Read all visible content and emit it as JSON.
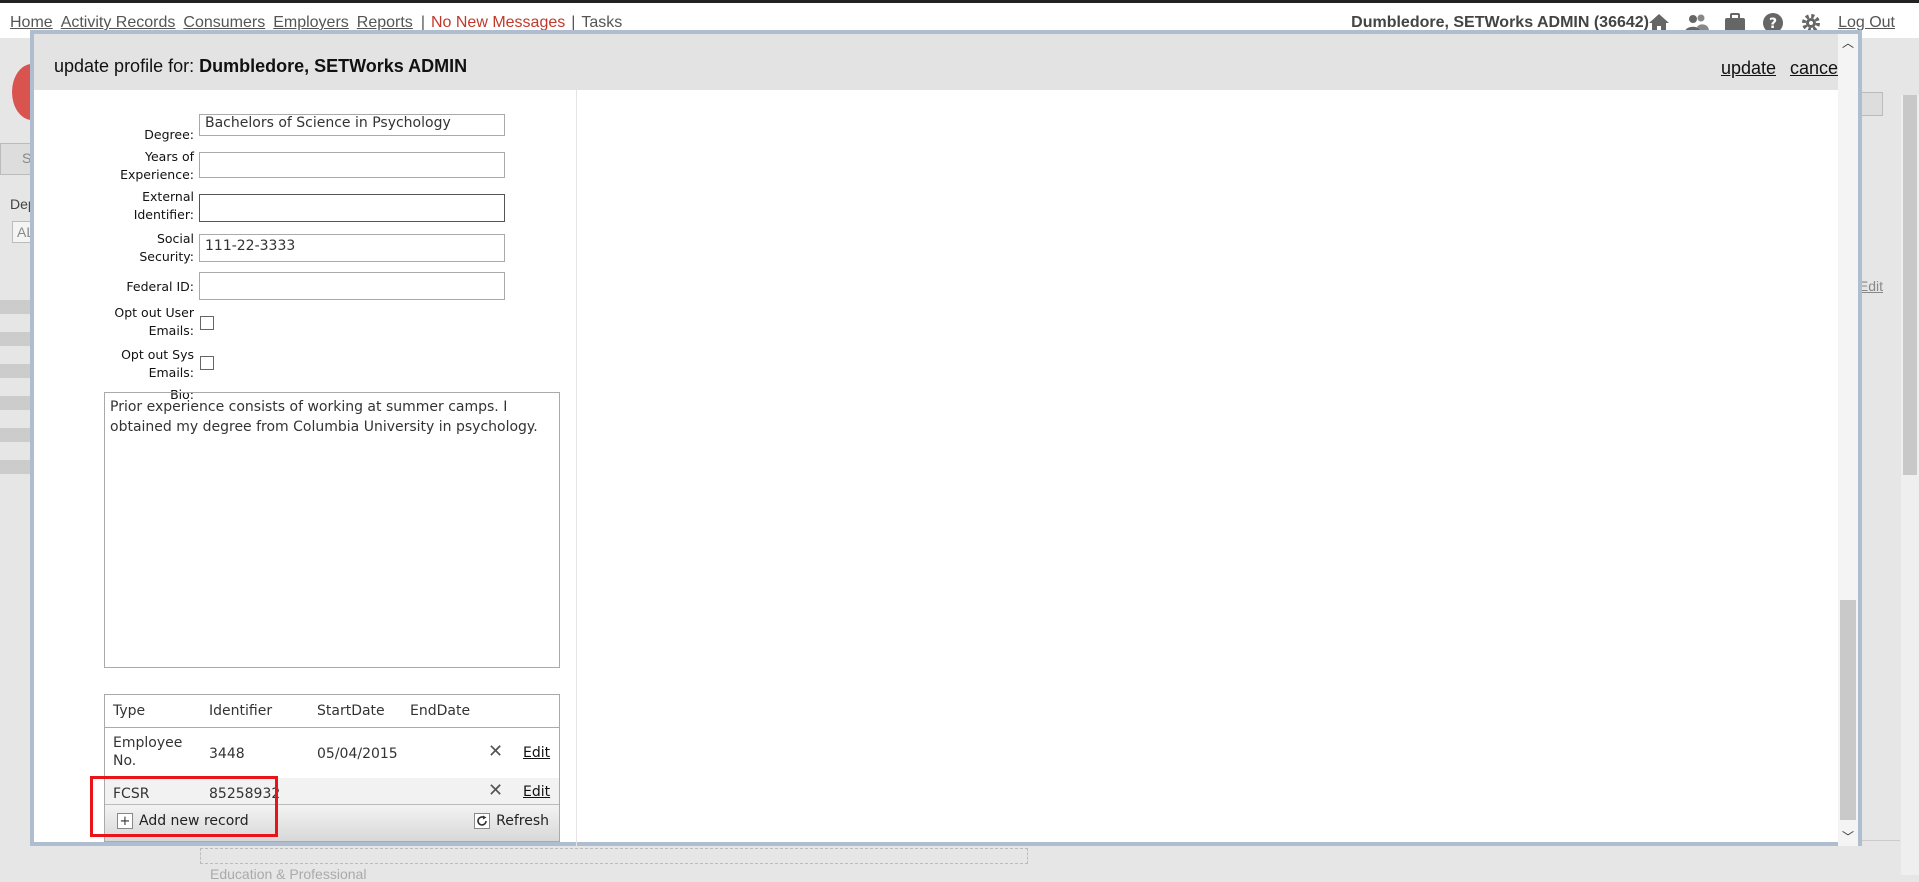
{
  "nav": {
    "links": [
      "Home",
      "Activity Records",
      "Consumers",
      "Employers",
      "Reports"
    ],
    "separator": "|",
    "messages": "No New Messages",
    "tasks": "Tasks"
  },
  "user": {
    "name": "Dumbledore, SETWorks ADMIN",
    "id": "(36642)",
    "logout": "Log Out"
  },
  "background": {
    "tab_fragment": "St",
    "label_fragment": "Dep",
    "select_fragment": "ALL",
    "edit_fragment": "Edit",
    "bottom_fragment": "Education & Professional"
  },
  "dialog": {
    "title_prefix": "update profile for:",
    "title_name": "Dumbledore, SETWorks ADMIN",
    "update_label": "update",
    "cancel_label": "cancel"
  },
  "form": {
    "degree": {
      "label": "Degree:",
      "value": "Bachelors of Science in Psychology"
    },
    "years": {
      "label_1": "Years of",
      "label_2": "Experience:",
      "value": ""
    },
    "external": {
      "label_1": "External",
      "label_2": "Identifier:",
      "value": ""
    },
    "ssn": {
      "label_1": "Social",
      "label_2": "Security:",
      "value": "111-22-3333"
    },
    "federal": {
      "label": "Federal ID:",
      "value": ""
    },
    "opt_user": {
      "label_1": "Opt out User",
      "label_2": "Emails:"
    },
    "opt_sys": {
      "label_1": "Opt out Sys",
      "label_2": "Emails:"
    },
    "bio": {
      "label": "Bio:",
      "value": "Prior experience consists of working at summer camps. I obtained my degree from Columbia University in psychology."
    }
  },
  "grid": {
    "headers": [
      "Type",
      "Identifier",
      "StartDate",
      "EndDate"
    ],
    "rows": [
      {
        "type_1": "Employee",
        "type_2": "No.",
        "identifier": "3448",
        "start": "05/04/2015",
        "end": "",
        "delete": "✕",
        "edit": "Edit"
      },
      {
        "type_1": "FCSR",
        "type_2": "",
        "identifier": "85258932",
        "start": "",
        "end": "",
        "delete": "✕",
        "edit": "Edit"
      }
    ],
    "add_label": "Add new record",
    "refresh_label": "Refresh"
  }
}
